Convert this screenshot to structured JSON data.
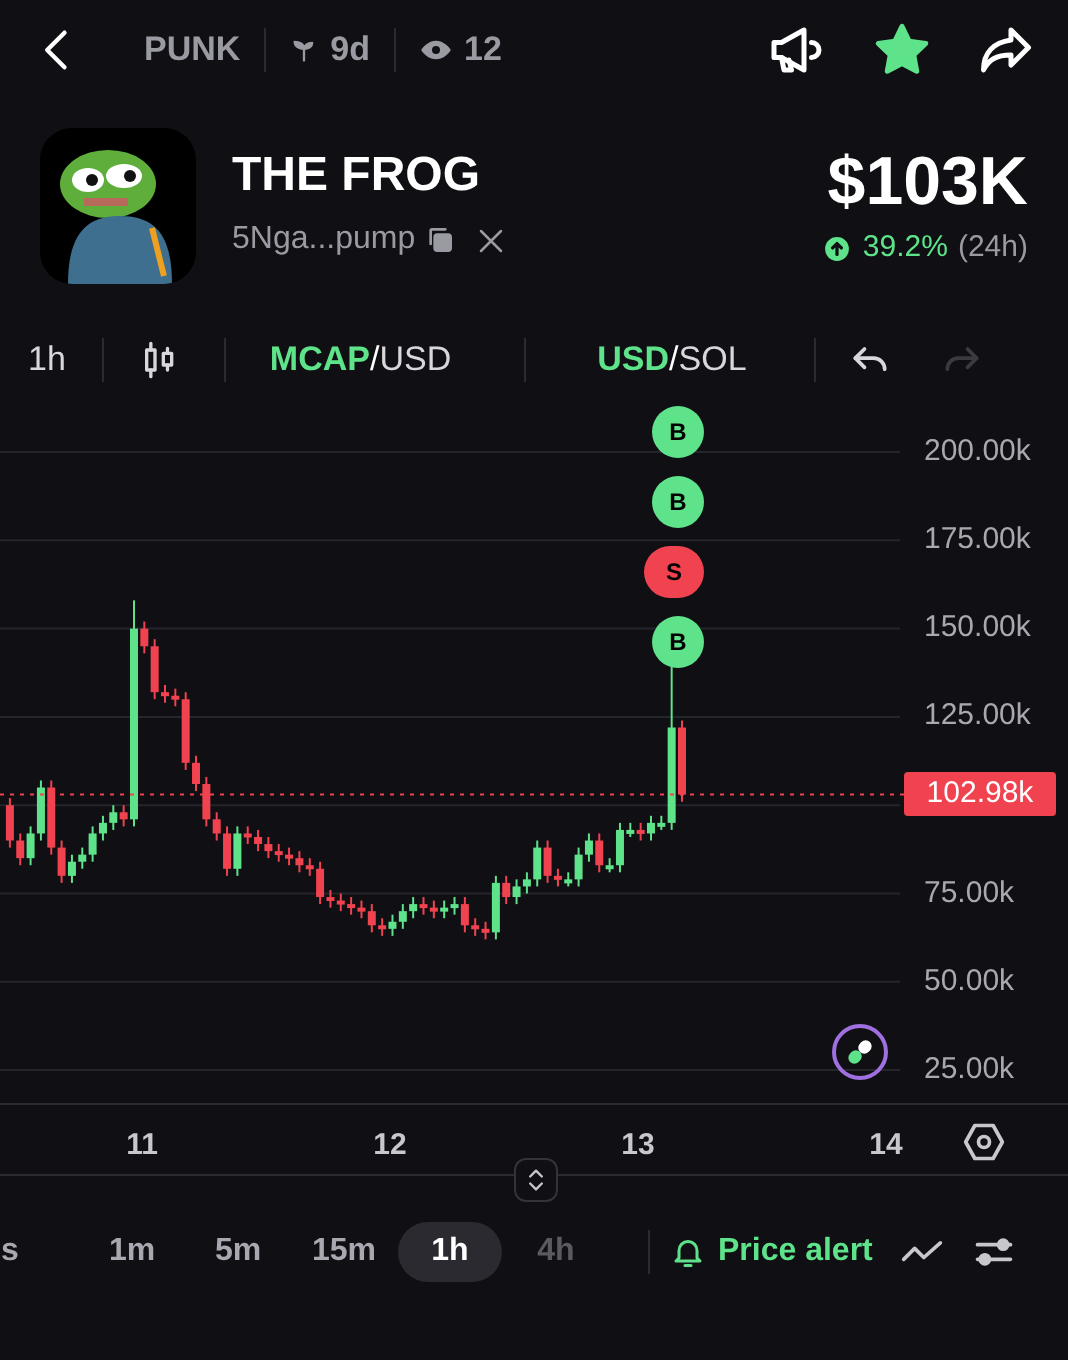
{
  "top_bar": {
    "ticker": "PUNK",
    "age": "9d",
    "watchers": "12",
    "favorite": true
  },
  "token": {
    "name": "THE FROG",
    "address": "5Nga...pump",
    "price": "$103K",
    "change": "39.2%",
    "period": "(24h)"
  },
  "toolbar": {
    "interval": "1h",
    "pairs": [
      {
        "parts": [
          {
            "label": "MCAP",
            "selected": true
          },
          {
            "label": "USD",
            "selected": false
          }
        ],
        "separator": "/"
      },
      {
        "parts": [
          {
            "label": "USD",
            "selected": true
          },
          {
            "label": "SOL",
            "selected": false
          }
        ],
        "separator": "/"
      }
    ],
    "undo_disabled": false,
    "redo_disabled": true
  },
  "chart": {
    "y_labels": [
      "200.00k",
      "175.00k",
      "150.00k",
      "125.00k",
      "75.00k",
      "50.00k",
      "25.00k"
    ],
    "current_price": "102.98k",
    "trade_markers": [
      {
        "label": "B",
        "kind": "buy"
      },
      {
        "label": "B",
        "kind": "buy"
      },
      {
        "label": "S",
        "kind": "sell"
      },
      {
        "label": "B",
        "kind": "buy"
      }
    ],
    "x_labels": [
      "11",
      "12",
      "13",
      "14"
    ]
  },
  "timeframes": [
    {
      "label": "s",
      "selected": false,
      "disabled": false
    },
    {
      "label": "1m",
      "selected": false,
      "disabled": false
    },
    {
      "label": "5m",
      "selected": false,
      "disabled": false
    },
    {
      "label": "15m",
      "selected": false,
      "disabled": false
    },
    {
      "label": "1h",
      "selected": true,
      "disabled": false
    },
    {
      "label": "4h",
      "selected": false,
      "disabled": true
    }
  ],
  "price_alert": "Price alert"
}
